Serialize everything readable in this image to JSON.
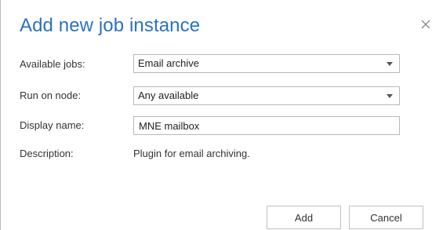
{
  "dialog": {
    "title": "Add new job instance",
    "close_icon": "close-icon"
  },
  "form": {
    "available_jobs": {
      "label": "Available jobs:",
      "value": "Email archive"
    },
    "run_on_node": {
      "label": "Run on node:",
      "value": "Any available"
    },
    "display_name": {
      "label": "Display name:",
      "value": "MNE mailbox"
    },
    "description": {
      "label": "Description:",
      "value": "Plugin for email archiving."
    }
  },
  "buttons": {
    "add": "Add",
    "cancel": "Cancel"
  },
  "colors": {
    "title": "#2a72c2",
    "border": "#b8b8b8"
  }
}
